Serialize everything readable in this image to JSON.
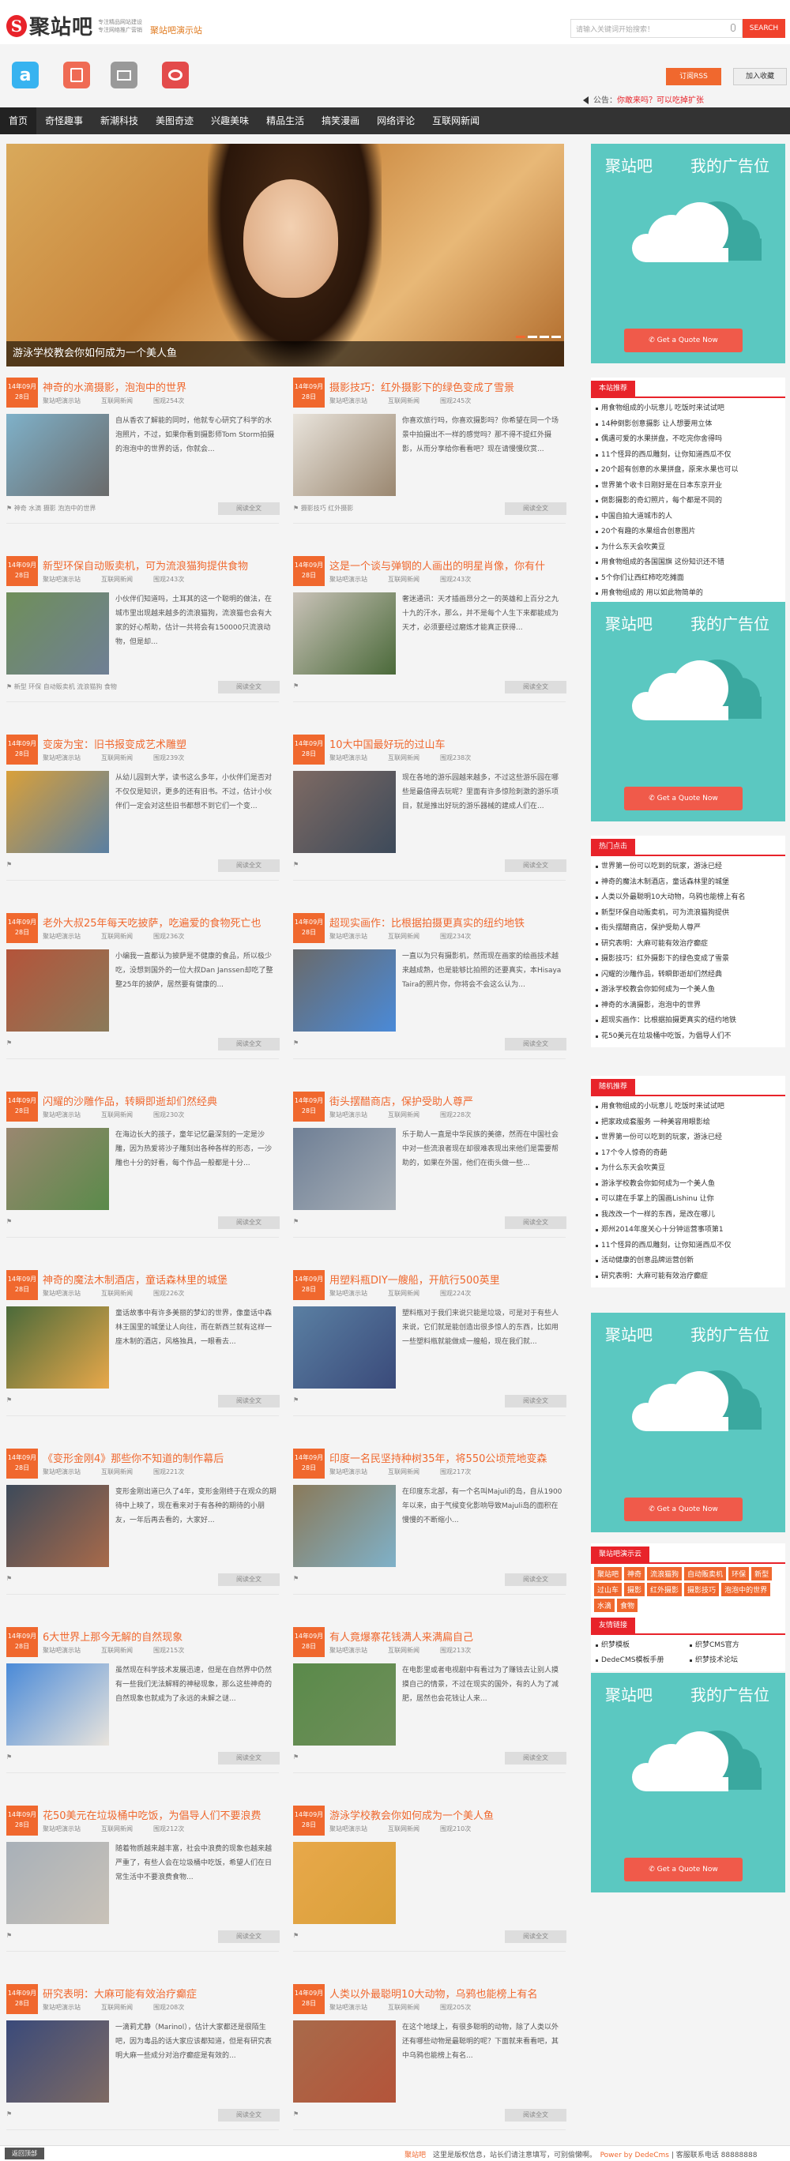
{
  "header": {
    "logo_letter": "S",
    "logo_name": "聚站吧",
    "slogan1": "专注精品网站建设",
    "slogan2": "专注网络推广营销",
    "site_title": "聚站吧演示站",
    "search_placeholder": "请输入关键词开始搜索！",
    "search_btn": "SEARCH"
  },
  "toolbar": {
    "rss": "订阅RSS",
    "fav": "加入收藏"
  },
  "notice": {
    "label": "公告：",
    "text": "你敢来吗？可以吃掉扩张"
  },
  "nav": [
    "首页",
    "奇怪趣事",
    "新潮科技",
    "美图奇迹",
    "兴趣美味",
    "精品生活",
    "搞笑漫画",
    "网络评论",
    "互联网新闻"
  ],
  "slider": {
    "caption": "游泳学校教会你如何成为一个美人鱼"
  },
  "articles": [
    {
      "date1": "14年09月",
      "date2": "28日",
      "title": "神奇的水滴摄影，泡泡中的世界",
      "site": "聚站吧演示站",
      "cat": "互联网新闻",
      "views": "围观254次",
      "desc": "自从香农了解能的同时，他就专心研究了科学的水泡照片，不过，如果你看到摄影师Tom Storm拍摄的泡泡中的世界的话，你就会...",
      "tags": "神奇 水滴 摄影 泡泡中的世界",
      "more": "阅读全文"
    },
    {
      "date1": "14年09月",
      "date2": "28日",
      "title": "摄影技巧：红外摄影下的绿色变成了雪景",
      "site": "聚站吧演示站",
      "cat": "互联网新闻",
      "views": "围观245次",
      "desc": "你喜欢旅行吗，你喜欢摄影吗？你希望在同一个场景中拍摄出不一样的感觉吗？那不得不提红外摄影，从而分享给你看看吧？现在请慢慢欣赏...",
      "tags": "摄影技巧 红外摄影",
      "more": "阅读全文"
    },
    {
      "date1": "14年09月",
      "date2": "28日",
      "title": "新型环保自动贩卖机，可为流浪猫狗提供食物",
      "site": "聚站吧演示站",
      "cat": "互联网新闻",
      "views": "围观243次",
      "desc": "小伙伴们知道吗，土耳其的这一个聪明的做法，在城市里出现越来越多的流浪猫狗，流浪猫也会有大家的好心帮助，估计一共将会有150000只流浪动物，但是却...",
      "tags": "新型 环保 自动贩卖机 流浪猫狗 食物",
      "more": "阅读全文"
    },
    {
      "date1": "14年09月",
      "date2": "28日",
      "title": "这是一个谈与弹钢的人画出的明星肖像，你有什",
      "site": "聚站吧演示站",
      "cat": "互联网新闻",
      "views": "围观243次",
      "desc": "奢迷通讯：天才插画昂分之一的英雄和上百分之九十九的汗水，那么，并不是每个人生下来都能成为天才，必须要经过磨炼才能真正获得...",
      "tags": "",
      "more": "阅读全文"
    },
    {
      "date1": "14年09月",
      "date2": "28日",
      "title": "变废为宝：旧书报变成艺术雕塑",
      "site": "聚站吧演示站",
      "cat": "互联网新闻",
      "views": "围观239次",
      "desc": "从幼儿园到大学，读书这么多年，小伙伴们是否对不仅仅是知识，更多的还有旧书。不过，估计小伙伴们一定会对这些旧书都想不到它们一个变...",
      "tags": "",
      "more": "阅读全文"
    },
    {
      "date1": "14年09月",
      "date2": "28日",
      "title": "10大中国最好玩的过山车",
      "site": "聚站吧演示站",
      "cat": "互联网新闻",
      "views": "围观238次",
      "desc": "现在各地的游乐园越来越多，不过这些游乐园在哪些是最值得去玩呢？里面有许多惊险刺激的游乐项目，就是推出好玩的游乐器械的建成人们在...",
      "tags": "",
      "more": "阅读全文"
    },
    {
      "date1": "14年09月",
      "date2": "28日",
      "title": "老外大叔25年每天吃披萨，吃遍爱的食物死亡也",
      "site": "聚站吧演示站",
      "cat": "互联网新闻",
      "views": "围观236次",
      "desc": "小编我一直都认为披萨是不健康的食品，所以极少吃，没想到国外的一位大叔Dan Janssen却吃了整整25年的披萨，居然要有健康的...",
      "tags": "",
      "more": "阅读全文"
    },
    {
      "date1": "14年09月",
      "date2": "28日",
      "title": "超现实画作：比根据拍摄更真实的纽约地铁",
      "site": "聚站吧演示站",
      "cat": "互联网新闻",
      "views": "围观234次",
      "desc": "一直以为只有摄影机，然而现在画家的绘画技术越来越成熟，也是能够比拍照的还要真实，本Hisaya Taira的照片你，你将会不会这么认为...",
      "tags": "",
      "more": "阅读全文"
    },
    {
      "date1": "14年09月",
      "date2": "28日",
      "title": "闪耀的沙雕作品，转瞬即逝却们然经典",
      "site": "聚站吧演示站",
      "cat": "互联网新闻",
      "views": "围观230次",
      "desc": "在海边长大的孩子，童年记忆最深刻的一定是沙雕，因为热爱将沙子雕刻出各种各样的形态，一沙雕也十分的好看，每个作品一般都是十分...",
      "tags": "",
      "more": "阅读全文"
    },
    {
      "date1": "14年09月",
      "date2": "28日",
      "title": "街头摆醋商店，保护受助人尊严",
      "site": "聚站吧演示站",
      "cat": "互联网新闻",
      "views": "围观228次",
      "desc": "乐于助人一直是中华民族的美德，然而在中国社会中对一些流浪者现在却很难表现出来他们是需要帮助的，如果在外国，他们在街头做一些...",
      "tags": "",
      "more": "阅读全文"
    },
    {
      "date1": "14年09月",
      "date2": "28日",
      "title": "神奇的魔法木制酒店，童话森林里的城堡",
      "site": "聚站吧演示站",
      "cat": "互联网新闻",
      "views": "围观226次",
      "desc": "童话故事中有许多美丽的梦幻的世界，像童话中森林王国里的城堡让人向往，而在新西兰就有这样一座木制的酒店，风格独具，一眼看去...",
      "tags": "",
      "more": "阅读全文"
    },
    {
      "date1": "14年09月",
      "date2": "28日",
      "title": "用塑料瓶DIY一艘船，开航行500英里",
      "site": "聚站吧演示站",
      "cat": "互联网新闻",
      "views": "围观224次",
      "desc": "塑料瓶对于我们来说只能是垃圾，可是对于有些人来说，它们就是能创造出很多惊人的东西，比如用一些塑料瓶就能做成一艘船，现在我们就...",
      "tags": "",
      "more": "阅读全文"
    },
    {
      "date1": "14年09月",
      "date2": "28日",
      "title": "《变形金刚4》那些你不知道的制作幕后",
      "site": "聚站吧演示站",
      "cat": "互联网新闻",
      "views": "围观221次",
      "desc": "变形金刚出道已久了4年，变形金刚终于在观众的期待中上映了，现在看来对于有各种的期待的小朋友，一年后再去看的，大家好...",
      "tags": "",
      "more": "阅读全文"
    },
    {
      "date1": "14年09月",
      "date2": "28日",
      "title": "印度一名民坚持种树35年，将550公顷荒地变森",
      "site": "聚站吧演示站",
      "cat": "互联网新闻",
      "views": "围观217次",
      "desc": "在印度东北部，有一个名叫Majuli的岛，自从1900年以来，由于气候变化影响导致Majuli岛的面积在慢慢的不断缩小...",
      "tags": "",
      "more": "阅读全文"
    },
    {
      "date1": "14年09月",
      "date2": "28日",
      "title": "6大世界上那今无解的自然现象",
      "site": "聚站吧演示站",
      "cat": "互联网新闻",
      "views": "围观215次",
      "desc": "虽然现在科学技术发展迅速，但是在自然界中仍然有一些我们无法解释的神秘现象，那么这些神奇的自然现象也就成为了永远的未解之谜...",
      "tags": "",
      "more": "阅读全文"
    },
    {
      "date1": "14年09月",
      "date2": "28日",
      "title": "有人竟爆寨花钱满人来满扁自己",
      "site": "聚站吧演示站",
      "cat": "互联网新闻",
      "views": "围观213次",
      "desc": "在电影里或者电视剧中有看过为了赚钱去让别人摸摸自己的情景，不过在现实的国外，有的人为了减肥，居然也会花钱让人来...",
      "tags": "",
      "more": "阅读全文"
    },
    {
      "date1": "14年09月",
      "date2": "28日",
      "title": "花50美元在垃圾桶中吃饭，为倡导人们不要浪费",
      "site": "聚站吧演示站",
      "cat": "互联网新闻",
      "views": "围观212次",
      "desc": "随着物质越来越丰富，社会中浪费的现象也越来越严重了，有些人会在垃圾桶中吃饭，希望人们在日常生活中不要浪费食物...",
      "tags": "",
      "more": "阅读全文"
    },
    {
      "date1": "14年09月",
      "date2": "28日",
      "title": "游泳学校教会你如何成为一个美人鱼",
      "site": "聚站吧演示站",
      "cat": "互联网新闻",
      "views": "围观210次",
      "desc": "",
      "tags": "",
      "more": "阅读全文"
    },
    {
      "date1": "14年09月",
      "date2": "28日",
      "title": "研究表明：大麻可能有效治疗癫症",
      "site": "聚站吧演示站",
      "cat": "互联网新闻",
      "views": "围观208次",
      "desc": "一滴莉尤静（Marinol），估计大家都还是很陌生吧，因为毒品的话大家应该都知道，但是有研究表明大麻一些成分对治疗癫症是有效的...",
      "tags": "",
      "more": "阅读全文"
    },
    {
      "date1": "14年09月",
      "date2": "28日",
      "title": "人类以外最聪明10大动物，乌鸦也能榜上有名",
      "site": "聚站吧演示站",
      "cat": "互联网新闻",
      "views": "围观205次",
      "desc": "在这个地球上，有很多聪明的动物，除了人类以外还有哪些动物是最聪明的呢？下面就来看看吧，其中乌鸦也能榜上有名...",
      "tags": "",
      "more": "阅读全文"
    }
  ],
  "sidebar": {
    "ad": {
      "t1": "聚站吧",
      "t2": "我的广告位",
      "quote": "Get a Quote Now"
    },
    "recommend_title": "本站推荐",
    "recommend": [
      "用食物组成的小玩意儿 吃饭时来试试吧",
      "14种倒影创意摄影 让人想要用立体",
      "偶遇可爱的水果拼盘，不吃完你舍得吗",
      "11个怪异的西瓜雕刻，让你知道西瓜不仅",
      "20个超有创意的水果拼盘，原来水果也可以",
      "世界第个收卡日刚好是在日本东京开业",
      "倒影摄影的奇幻照片，每个都是不同的",
      "中国自拍大道城市的人",
      "20个有趣的水果组合创意图片",
      "为什么东天会吹黄豆",
      "用食物组成的各国国旗 这份知识还不错",
      "5个你们让西红柿吃吃摊面",
      "用食物组成的 用以如此物简单的"
    ],
    "hot_title": "热门点击",
    "hot": [
      "世界第一份可以吃到的玩家，游泳已经",
      "神奇的魔法木制酒店，童话森林里的城堡",
      "人类以外最聪明10大动物，乌鸦也能榜上有名",
      "新型环保自动贩卖机，可为流浪猫狗提供",
      "街头摆醋商店，保护受助人尊严",
      "研究表明：大麻可能有效治疗癫症",
      "摄影技巧：红外摄影下的绿色变成了雪景",
      "闪耀的沙雕作品，转瞬即逝却们然经典",
      "游泳学校教会你如何成为一个美人鱼",
      "神奇的水滴摄影，泡泡中的世界",
      "超现实画作：比根据拍摄更真实的纽约地铁",
      "花50美元在垃圾桶中吃饭，为倡导人们不"
    ],
    "rand_title": "随机推荐",
    "rand": [
      "用食物组成的小玩意儿 吃饭时来试试吧",
      "把家政成套服务 一种美容用眼影绘",
      "世界第一份可以吃到的玩家，游泳已经",
      "17个令人惊奇的奇葩",
      "为什么东天会吹黄豆",
      "游泳学校教会你如何成为一个美人鱼",
      "可以建在手掌上的国画Lishinu 让你",
      "我改改一个一样的东西，是改在哪儿",
      "郑州2014年度关心十分钟运营事项第1",
      "11个怪异的西瓜雕刻，让你知道西瓜不仅",
      "活动健康的创意品牌运营创新",
      "研究表明：大麻可能有效治疗癫症"
    ],
    "tags_title": "聚站吧演示云",
    "tags": [
      "聚站吧",
      "神奇",
      "流浪猫狗",
      "自动贩卖机",
      "环保",
      "新型",
      "过山车",
      "摄影",
      "红外摄影",
      "摄影技巧",
      "泡泡中的世界",
      "水滴",
      "食物"
    ],
    "links_title": "友情链接",
    "links": [
      "织梦模板",
      "织梦CMS官方",
      "DedeCMS模板手册",
      "织梦技术论坛"
    ]
  },
  "footer": {
    "back": "返回顶部",
    "site": "聚站吧",
    "text": "这里是版权信息，站长们请注意填写，可别偷懒啊。",
    "power": "Power by DedeCms",
    "tel": "| 客服联系电话 88888888"
  }
}
